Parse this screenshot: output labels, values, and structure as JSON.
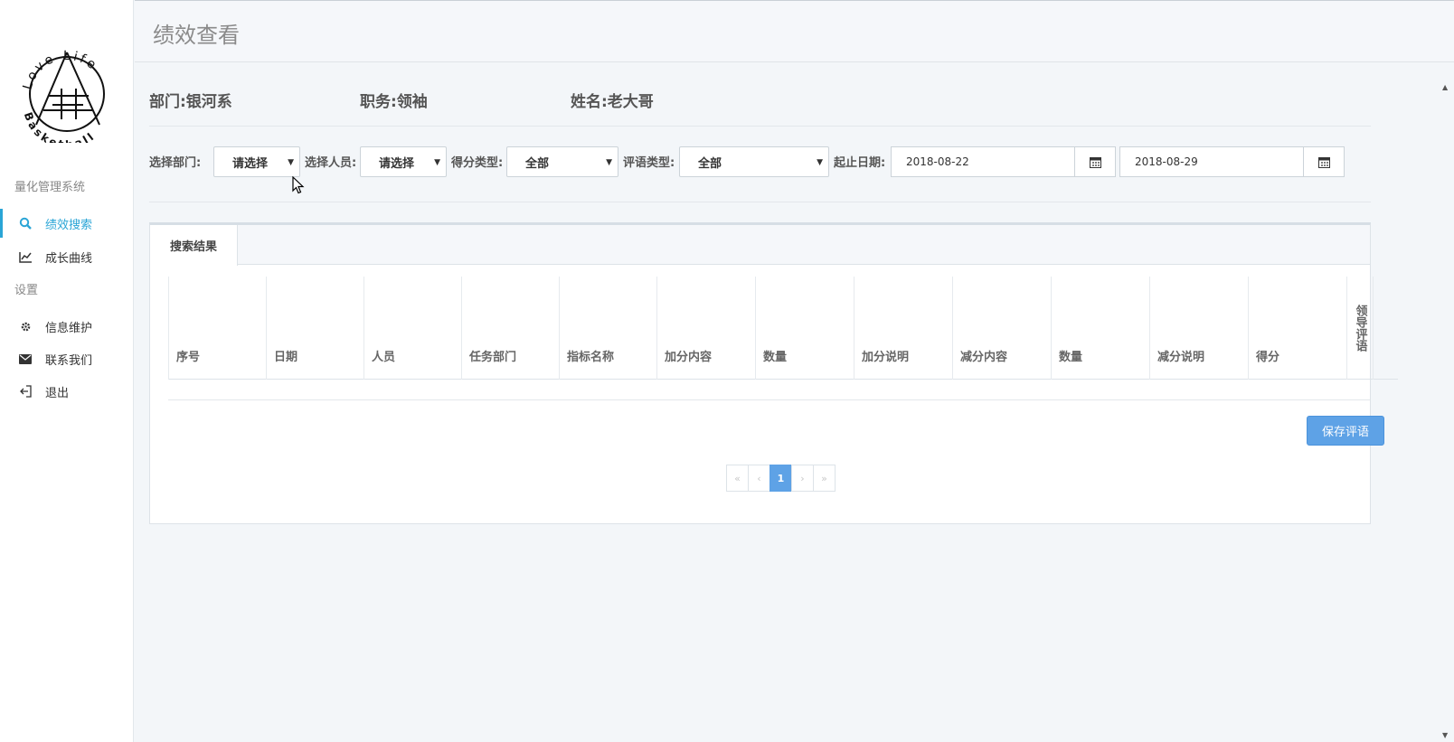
{
  "sidebar": {
    "logo": {
      "top_text": "Love Life",
      "bottom_text": "Basketball"
    },
    "section1": "量化管理系统",
    "section2": "设置",
    "items": [
      {
        "label": "绩效搜索",
        "icon": "search-icon"
      },
      {
        "label": "成长曲线",
        "icon": "line-chart-icon"
      },
      {
        "label": "信息维护",
        "icon": "gear-icon"
      },
      {
        "label": "联系我们",
        "icon": "envelope-icon"
      },
      {
        "label": "退出",
        "icon": "sign-out-icon"
      }
    ]
  },
  "header": {
    "title": "绩效查看"
  },
  "info": {
    "department": "部门:银河系",
    "position": "职务:领袖",
    "name": "姓名:老大哥"
  },
  "filters": {
    "dept_label": "选择部门:",
    "dept_value": "请选择",
    "person_label": "选择人员:",
    "person_value": "请选择",
    "score_type_label": "得分类型:",
    "score_type_value": "全部",
    "comment_type_label": "评语类型:",
    "comment_type_value": "全部",
    "date_label": "起止日期:",
    "start_date": "2018-08-22",
    "end_date": "2018-08-29"
  },
  "results": {
    "tab_label": "搜索结果",
    "columns": [
      "序号",
      "日期",
      "人员",
      "任务部门",
      "指标名称",
      "加分内容",
      "数量",
      "加分说明",
      "减分内容",
      "数量",
      "减分说明",
      "得分",
      "领导评语"
    ],
    "save_button": "保存评语",
    "pagination": {
      "first": "«",
      "prev": "‹",
      "current": "1",
      "next": "›",
      "last": "»"
    }
  },
  "colors": {
    "accent": "#2aa5d6",
    "button": "#5ea2e6"
  }
}
